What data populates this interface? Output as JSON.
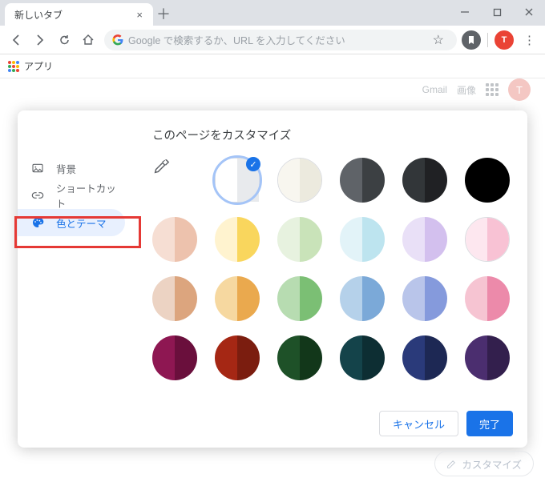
{
  "window": {
    "tab_title": "新しいタブ",
    "new_tab": "＋"
  },
  "toolbar": {
    "omnibox_placeholder": "Google で検索するか、URL を入力してください",
    "profile_initial": "T"
  },
  "bookmarks": {
    "apps_label": "アプリ"
  },
  "ntp": {
    "link_gmail": "Gmail",
    "link_images": "画像",
    "avatar_initial": "T",
    "avatar_color": "#f4c7c3",
    "customize_label": "カスタマイズ"
  },
  "dialog": {
    "title": "このページをカスタマイズ",
    "sidebar": {
      "background": "背景",
      "shortcuts": "ショートカット",
      "color_theme": "色とテーマ"
    },
    "footer": {
      "cancel": "キャンセル",
      "done": "完了"
    },
    "swatches": [
      {
        "type": "picker"
      },
      {
        "left": "#ffffff",
        "right": "#e8eaed",
        "selected": true,
        "outline": true
      },
      {
        "left": "#f8f6ef",
        "right": "#eceade",
        "outline": true
      },
      {
        "left": "#5f6368",
        "right": "#3c4043"
      },
      {
        "left": "#323639",
        "right": "#202124"
      },
      {
        "left": "#000000",
        "right": "#000000"
      },
      {
        "left": "#f6ded3",
        "right": "#edc2ad"
      },
      {
        "left": "#fff3cf",
        "right": "#f9d65d"
      },
      {
        "left": "#e7f2df",
        "right": "#c9e3b9"
      },
      {
        "left": "#e2f3f8",
        "right": "#bde4ef"
      },
      {
        "left": "#e9e0f7",
        "right": "#d3c0ee"
      },
      {
        "left": "#fde7ef",
        "right": "#f8c2d4",
        "outline": true
      },
      {
        "left": "#ecd3c3",
        "right": "#dca57e"
      },
      {
        "left": "#f6d8a0",
        "right": "#eaa94e"
      },
      {
        "left": "#b7dcb1",
        "right": "#7bbf74"
      },
      {
        "left": "#b5d1ea",
        "right": "#7ba9d8"
      },
      {
        "left": "#b9c5ea",
        "right": "#859adc"
      },
      {
        "left": "#f6c4d2",
        "right": "#ec8aaa"
      },
      {
        "left": "#8e1752",
        "right": "#6a0f3c"
      },
      {
        "left": "#a52714",
        "right": "#7b1d0f"
      },
      {
        "left": "#1e5128",
        "right": "#12371a"
      },
      {
        "left": "#14434a",
        "right": "#0d2e33"
      },
      {
        "left": "#2a3a7a",
        "right": "#1d2854"
      },
      {
        "left": "#4b2e6f",
        "right": "#331f4d"
      }
    ]
  }
}
